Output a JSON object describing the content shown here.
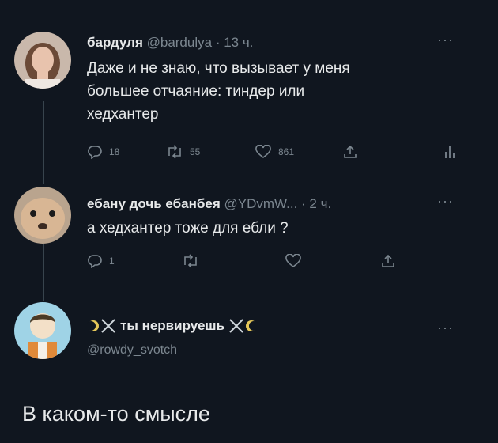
{
  "tweets": [
    {
      "name": "бардуля",
      "handle": "@bardulya",
      "time": "· 13 ч.",
      "more": "···",
      "text_lines": [
        "Даже и не знаю, что вызывает у меня",
        "большее отчаяние: тиндер или",
        "хедхантер"
      ],
      "actions": {
        "reply_count": "18",
        "retweet_count": "55",
        "like_count": "861"
      }
    },
    {
      "name": "ебану дочь ебанбея",
      "handle": "@YDvmW...",
      "time": "· 2 ч.",
      "more": "···",
      "text_lines": [
        "а хедхантер тоже для ебли ?"
      ],
      "actions": {
        "reply_count": "1",
        "retweet_count": "",
        "like_count": ""
      }
    },
    {
      "name": "ты нервируешь",
      "handle": "@rowdy_svotch",
      "more": "···"
    }
  ],
  "reply_text": "В каком-то смысле",
  "colors": {
    "background": "#10161f",
    "text": "#e7e9ea",
    "muted": "#7b868f",
    "line": "#38444d"
  },
  "icons": [
    "reply-icon",
    "retweet-icon",
    "like-icon",
    "share-icon",
    "analytics-icon",
    "crossed-swords-icon",
    "moon-icon"
  ]
}
